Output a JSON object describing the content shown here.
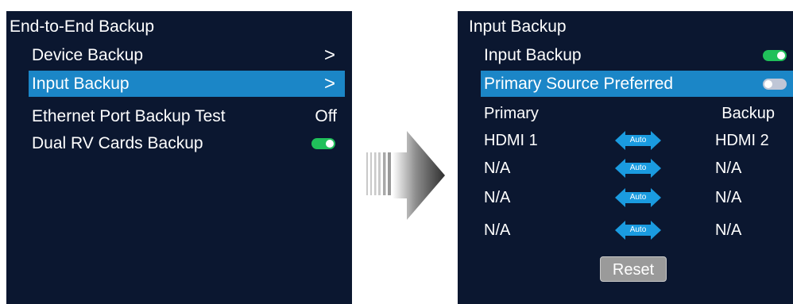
{
  "left": {
    "title": "End-to-End Backup",
    "items": [
      {
        "label": "Device Backup",
        "value": ">"
      },
      {
        "label": "Input Backup",
        "value": ">"
      },
      {
        "label": "Ethernet Port Backup Test",
        "value": "Off"
      },
      {
        "label": "Dual RV Cards Backup",
        "value": "on"
      }
    ]
  },
  "right": {
    "title": "Input Backup",
    "items": [
      {
        "label": "Input Backup",
        "value": "on"
      },
      {
        "label": "Primary Source Preferred",
        "value": "off"
      }
    ],
    "columns": {
      "primary": "Primary",
      "backup": "Backup"
    },
    "pairs": [
      {
        "primary": "HDMI 1",
        "mode": "Auto",
        "backup": "HDMI 2"
      },
      {
        "primary": "N/A",
        "mode": "Auto",
        "backup": "N/A"
      },
      {
        "primary": "N/A",
        "mode": "Auto",
        "backup": "N/A"
      },
      {
        "primary": "N/A",
        "mode": "Auto",
        "backup": "N/A"
      }
    ],
    "reset_label": "Reset"
  },
  "colors": {
    "panel_bg": "#0b1730",
    "selected_row": "#1b86c7",
    "toggle_on": "#20c05a",
    "toggle_off": "#bfc6d6",
    "auto_arrow": "#1a9be0"
  },
  "icons": {
    "chevron": "chevron-right-icon",
    "toggle": "toggle-switch-icon",
    "auto": "bidirectional-arrow-icon",
    "transition": "transition-arrow-icon"
  }
}
